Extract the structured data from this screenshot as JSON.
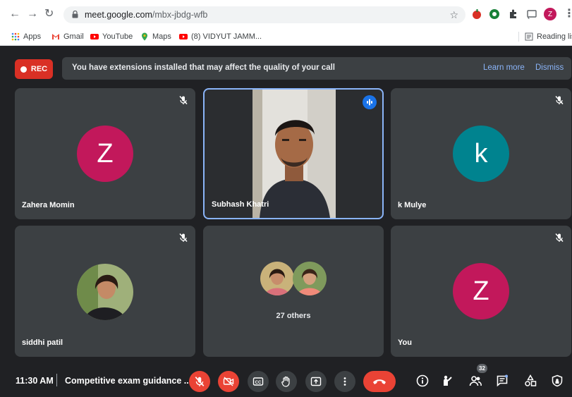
{
  "browser": {
    "url_host": "meet.google.com",
    "url_path": "/mbx-jbdg-wfb",
    "profile_initial": "Z",
    "bookmarks": [
      {
        "label": "Apps",
        "icon": "apps-grid-icon"
      },
      {
        "label": "Gmail",
        "icon": "gmail-icon"
      },
      {
        "label": "YouTube",
        "icon": "youtube-icon"
      },
      {
        "label": "Maps",
        "icon": "maps-icon"
      },
      {
        "label": "(8) VIDYUT JAMM...",
        "icon": "youtube-icon"
      }
    ],
    "reading_list": "Reading list"
  },
  "banner": {
    "rec_label": "REC",
    "message": "You have extensions installed that may affect the quality of your call",
    "learn_more": "Learn more",
    "dismiss": "Dismiss"
  },
  "tiles": [
    {
      "name": "Zahera Momin",
      "initial": "Z",
      "color": "#c2185b",
      "muted": true
    },
    {
      "name": "Subhash Khatri",
      "speaking": true
    },
    {
      "name": "k Mulye",
      "initial": "k",
      "color": "#00838f",
      "muted": true
    },
    {
      "name": "siddhi patil",
      "muted": true
    },
    {
      "name": "27 others"
    },
    {
      "name": "You",
      "initial": "Z",
      "color": "#c2185b",
      "muted": true
    }
  ],
  "bottom_bar": {
    "time": "11:30 AM",
    "meeting_title": "Competitive exam guidance ...",
    "participant_count": "32"
  },
  "colors": {
    "accent": "#8ab4f8",
    "danger": "#ea4335",
    "tile_bg": "#3c4043",
    "page_bg": "#202124"
  }
}
